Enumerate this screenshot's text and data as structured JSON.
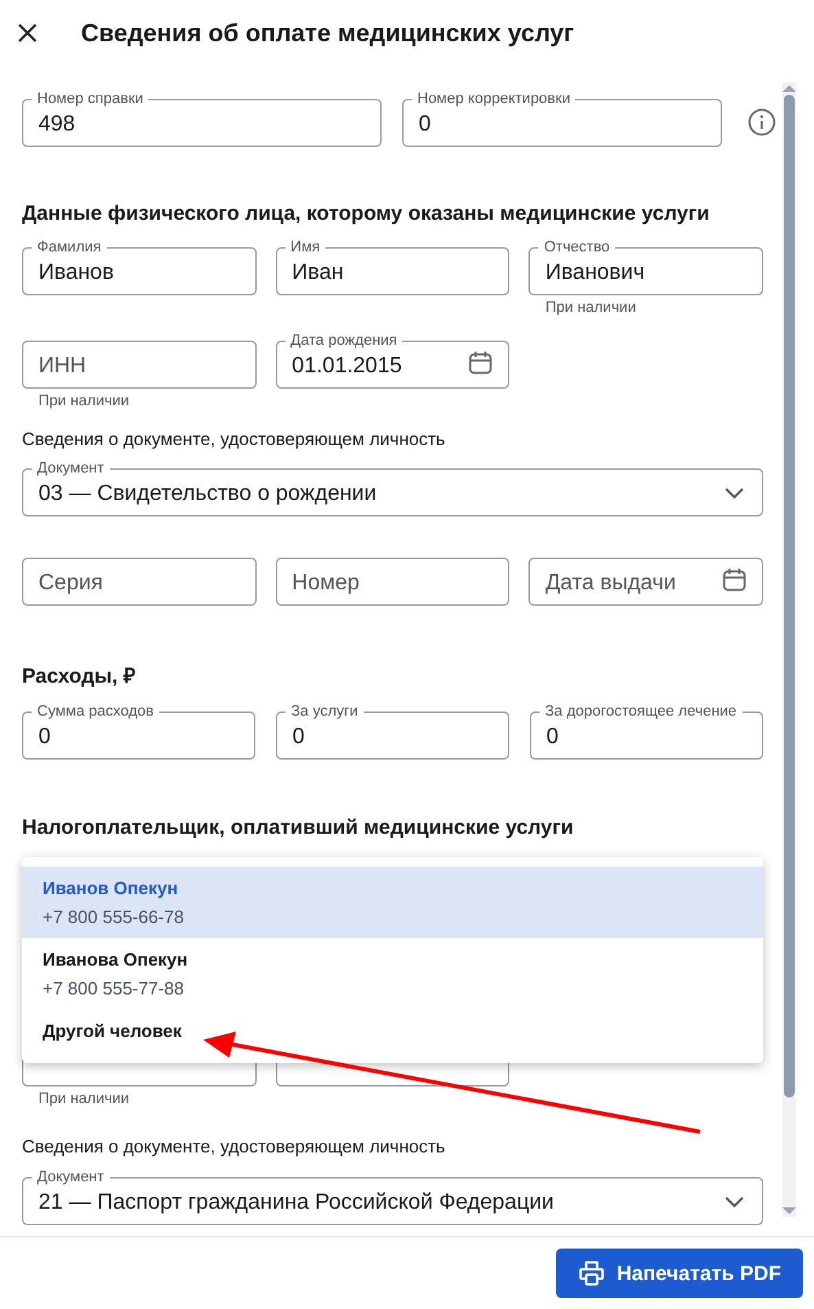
{
  "header": {
    "title": "Сведения об оплате медицинских услуг"
  },
  "top_fields": [
    {
      "label": "Номер справки",
      "value": "498"
    },
    {
      "label": "Номер корректировки",
      "value": "0"
    }
  ],
  "patient": {
    "heading": "Данные физического лица, которому оказаны медицинские услуги",
    "name_fields": [
      {
        "label": "Фамилия",
        "value": "Иванов"
      },
      {
        "label": "Имя",
        "value": "Иван"
      },
      {
        "label": "Отчество",
        "value": "Иванович",
        "helper": "При наличии"
      }
    ],
    "inn": {
      "placeholder": "ИНН",
      "helper": "При наличии"
    },
    "birth_date": {
      "label": "Дата рождения",
      "value": "01.01.2015"
    },
    "document_caption": "Сведения о документе, удостоверяющем личность",
    "document": {
      "label": "Документ",
      "value": "03 — Свидетельство о рождении"
    },
    "series": {
      "placeholder": "Серия"
    },
    "number": {
      "placeholder": "Номер"
    },
    "issue_date": {
      "placeholder": "Дата выдачи"
    }
  },
  "expenses": {
    "heading": "Расходы, ₽",
    "fields": [
      {
        "label": "Сумма расходов",
        "value": "0"
      },
      {
        "label": "За услуги",
        "value": "0"
      },
      {
        "label": "За дорогостоящее лечение",
        "value": "0"
      }
    ]
  },
  "payer": {
    "heading": "Налогоплательщик, оплативший медицинские услуги",
    "menu": {
      "options": [
        {
          "name": "Иванов Опекун",
          "phone": "+7 800 555-66-78",
          "selected": true
        },
        {
          "name": "Иванова Опекун",
          "phone": "+7 800 555-77-88",
          "selected": false
        },
        {
          "name": "Другой человек",
          "selected": false
        }
      ]
    },
    "inn_helper": "При наличии",
    "document_caption": "Сведения о документе, удостоверяющем личность",
    "document": {
      "label": "Документ",
      "value": "21 — Паспорт гражданина Российской Федерации"
    }
  },
  "footer": {
    "print_button": "Напечатать PDF"
  }
}
